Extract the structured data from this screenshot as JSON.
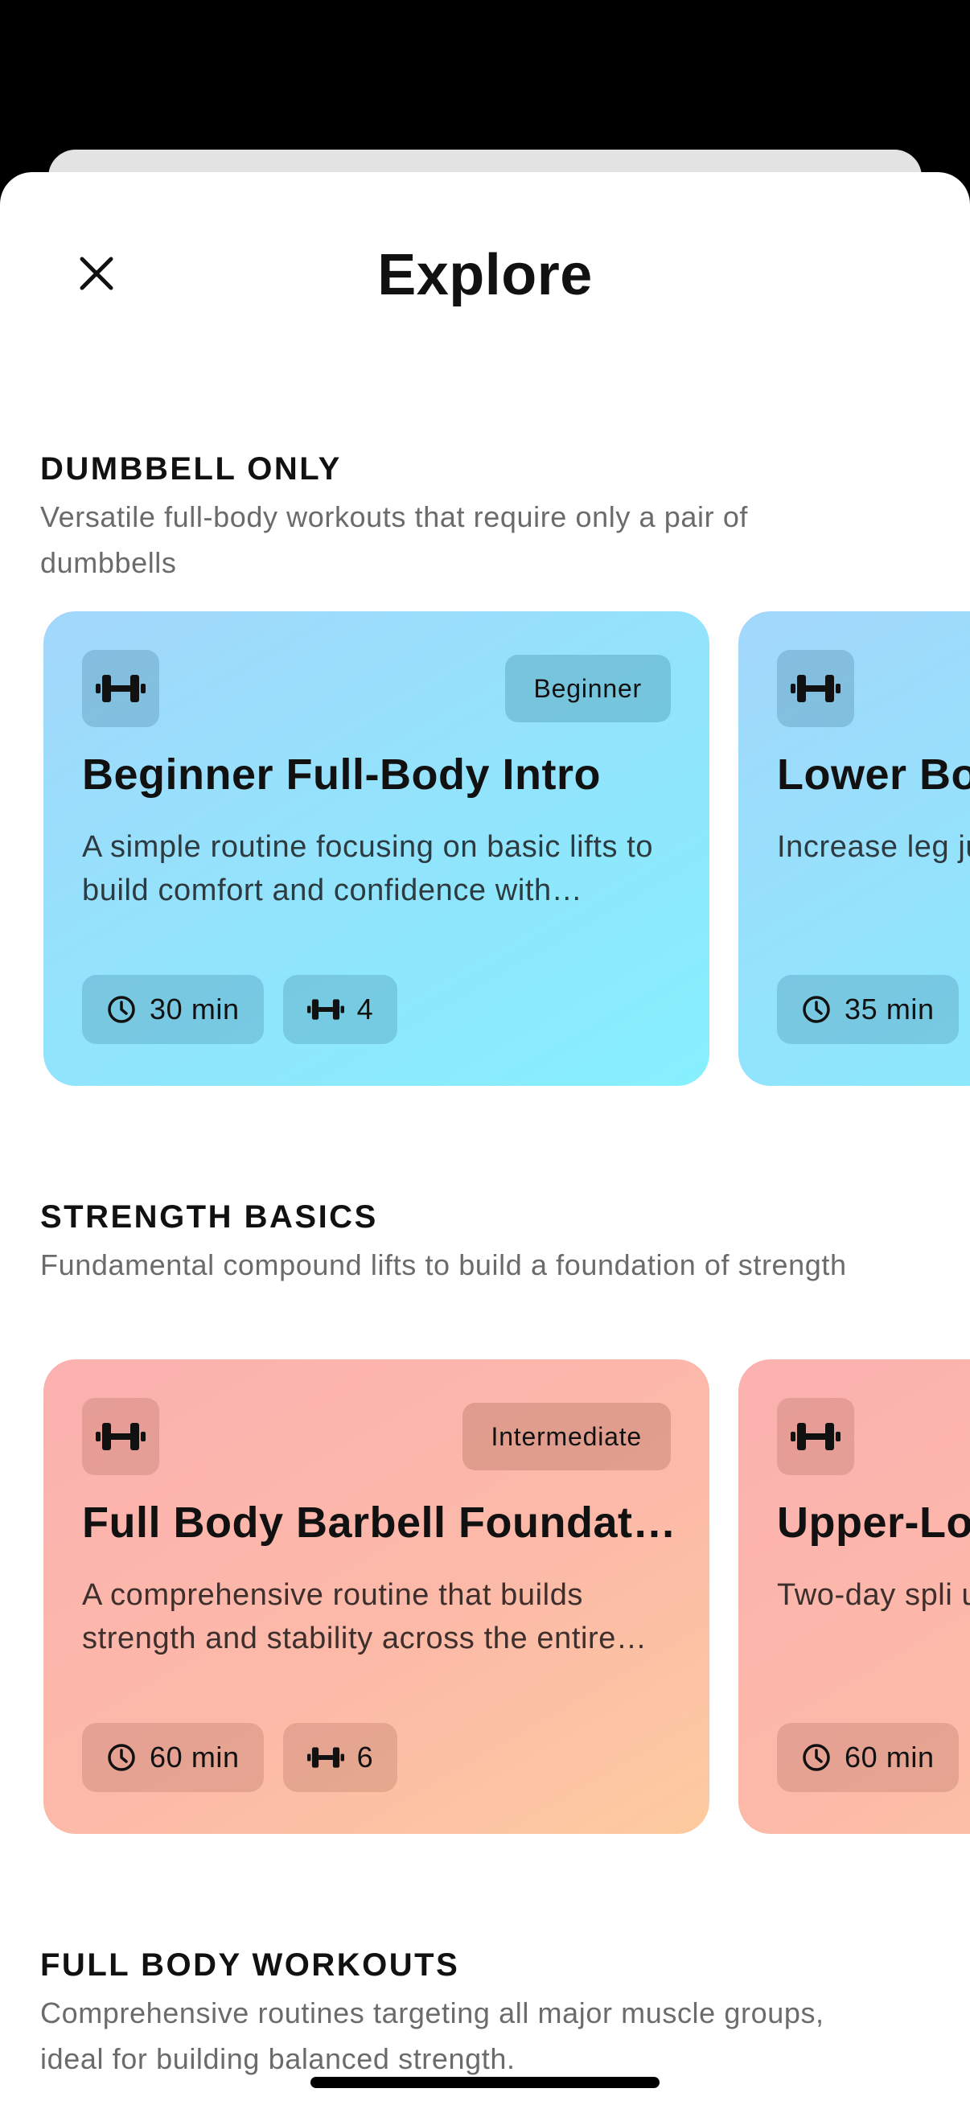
{
  "header": {
    "title": "Explore",
    "close_icon": "close-icon"
  },
  "sections": [
    {
      "heading": "DUMBBELL ONLY",
      "description": "Versatile full-body workouts that require only a pair of dumbbells",
      "cards": [
        {
          "icon": "dumbbell-icon",
          "level": "Beginner",
          "title": "Beginner Full-Body Intro",
          "description": "A simple routine focusing on basic lifts to build comfort and confidence with dumbbells",
          "duration": "30 min",
          "exercises": "4",
          "theme": "blue"
        },
        {
          "icon": "dumbbell-icon",
          "level": "",
          "title": "Lower Bo",
          "description": "Increase leg just dumbbe",
          "duration": "35 min",
          "exercises": "",
          "theme": "blue"
        }
      ]
    },
    {
      "heading": "STRENGTH BASICS",
      "description": "Fundamental compound lifts to build a foundation of strength",
      "cards": [
        {
          "icon": "dumbbell-icon",
          "level": "Intermediate",
          "title": "Full Body Barbell Foundation",
          "description": "A comprehensive routine that builds strength and stability across the entire body",
          "duration": "60 min",
          "exercises": "6",
          "theme": "red"
        },
        {
          "icon": "dumbbell-icon",
          "level": "",
          "title": "Upper-Lo",
          "description": "Two-day spli upper and lo",
          "duration": "60 min",
          "exercises": "",
          "theme": "red"
        }
      ]
    },
    {
      "heading": "FULL BODY WORKOUTS",
      "description": "Comprehensive routines targeting all major muscle groups, ideal for building balanced strength."
    }
  ],
  "colors": {
    "sheet_background": "#ffffff",
    "blue_card_start": "#a3d7fb",
    "blue_card_end": "#86f0fd",
    "red_card_start": "#fbb1b0",
    "red_card_end": "#fdcba0",
    "section_description": "#6b6b6b"
  }
}
